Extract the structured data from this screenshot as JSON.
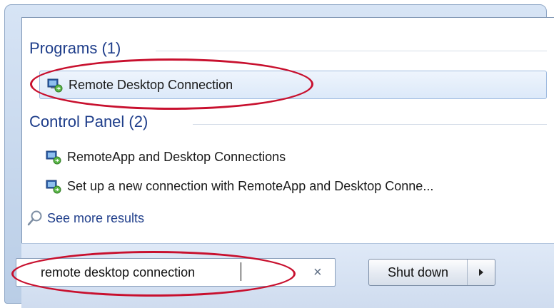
{
  "sections": {
    "programs": {
      "header": "Programs (1)",
      "items": [
        "Remote Desktop Connection"
      ]
    },
    "control_panel": {
      "header": "Control Panel (2)",
      "items": [
        "RemoteApp and Desktop Connections",
        "Set up a new connection with RemoteApp and Desktop Conne..."
      ]
    }
  },
  "see_more": {
    "label": "See more results"
  },
  "search": {
    "value": "remote desktop connection",
    "clear_glyph": "×"
  },
  "shutdown": {
    "label": "Shut down"
  },
  "icons": {
    "program": "remote-desktop-icon",
    "see_more": "magnifier-icon",
    "shutdown_options": "triangle-right-icon"
  },
  "colors": {
    "section_header": "#1e3d8a",
    "selection_border": "#9fbbe0",
    "annotation": "#c8102e"
  }
}
